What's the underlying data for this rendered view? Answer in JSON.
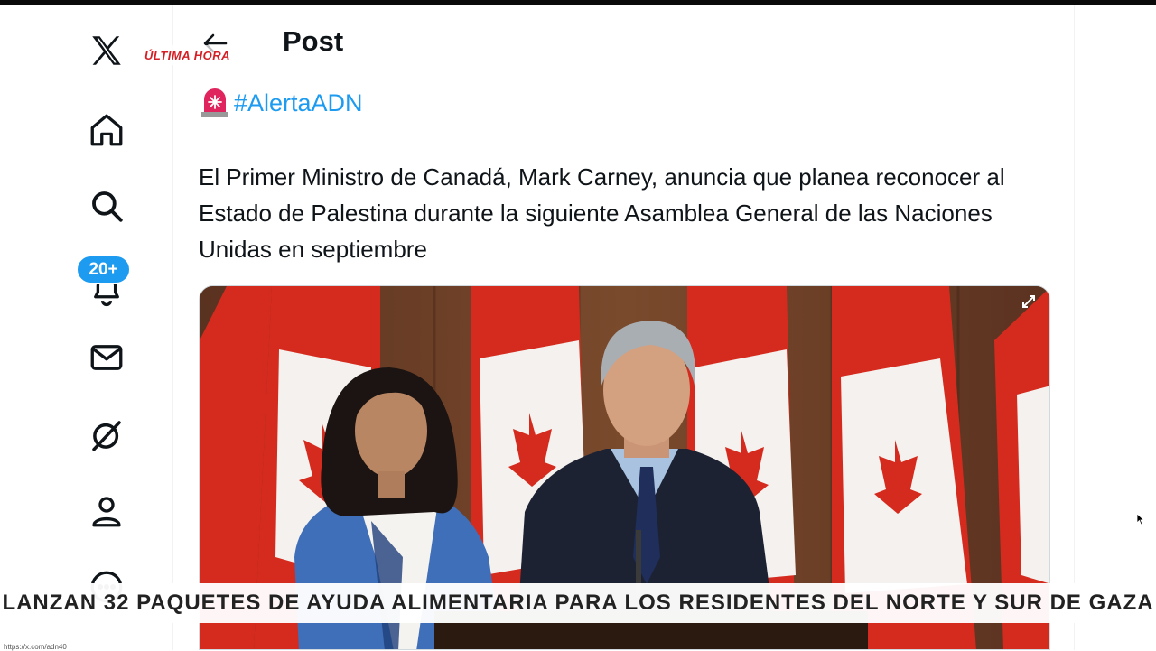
{
  "header": {
    "back_icon": "arrow-left-icon",
    "title": "Post"
  },
  "overlay": {
    "breaking_label": "ÚLTIMA HORA",
    "ticker": "LANZAN 32 PAQUETES DE AYUDA ALIMENTARIA PARA LOS RESIDENTES DEL NORTE Y SUR DE GAZA",
    "url_hint": "https://x.com/adn40"
  },
  "sidebar": {
    "items": [
      {
        "name": "x-logo-icon"
      },
      {
        "name": "home-icon"
      },
      {
        "name": "search-icon"
      },
      {
        "name": "notifications-icon",
        "badge": "20+"
      },
      {
        "name": "messages-icon"
      },
      {
        "name": "grok-icon"
      },
      {
        "name": "profile-icon"
      },
      {
        "name": "more-icon"
      }
    ]
  },
  "post": {
    "hashtag": "#AlertaADN",
    "siren_icon": "siren-icon",
    "text": "El Primer Ministro de Canadá, Mark Carney, anuncia que planea reconocer al Estado de Palestina durante la siguiente Asamblea General de las Naciones Unidas en septiembre"
  },
  "colors": {
    "accent": "#1d9bf0",
    "text": "#0f1419",
    "flag_red": "#d52b1e",
    "breaking_red": "#d41f26"
  }
}
